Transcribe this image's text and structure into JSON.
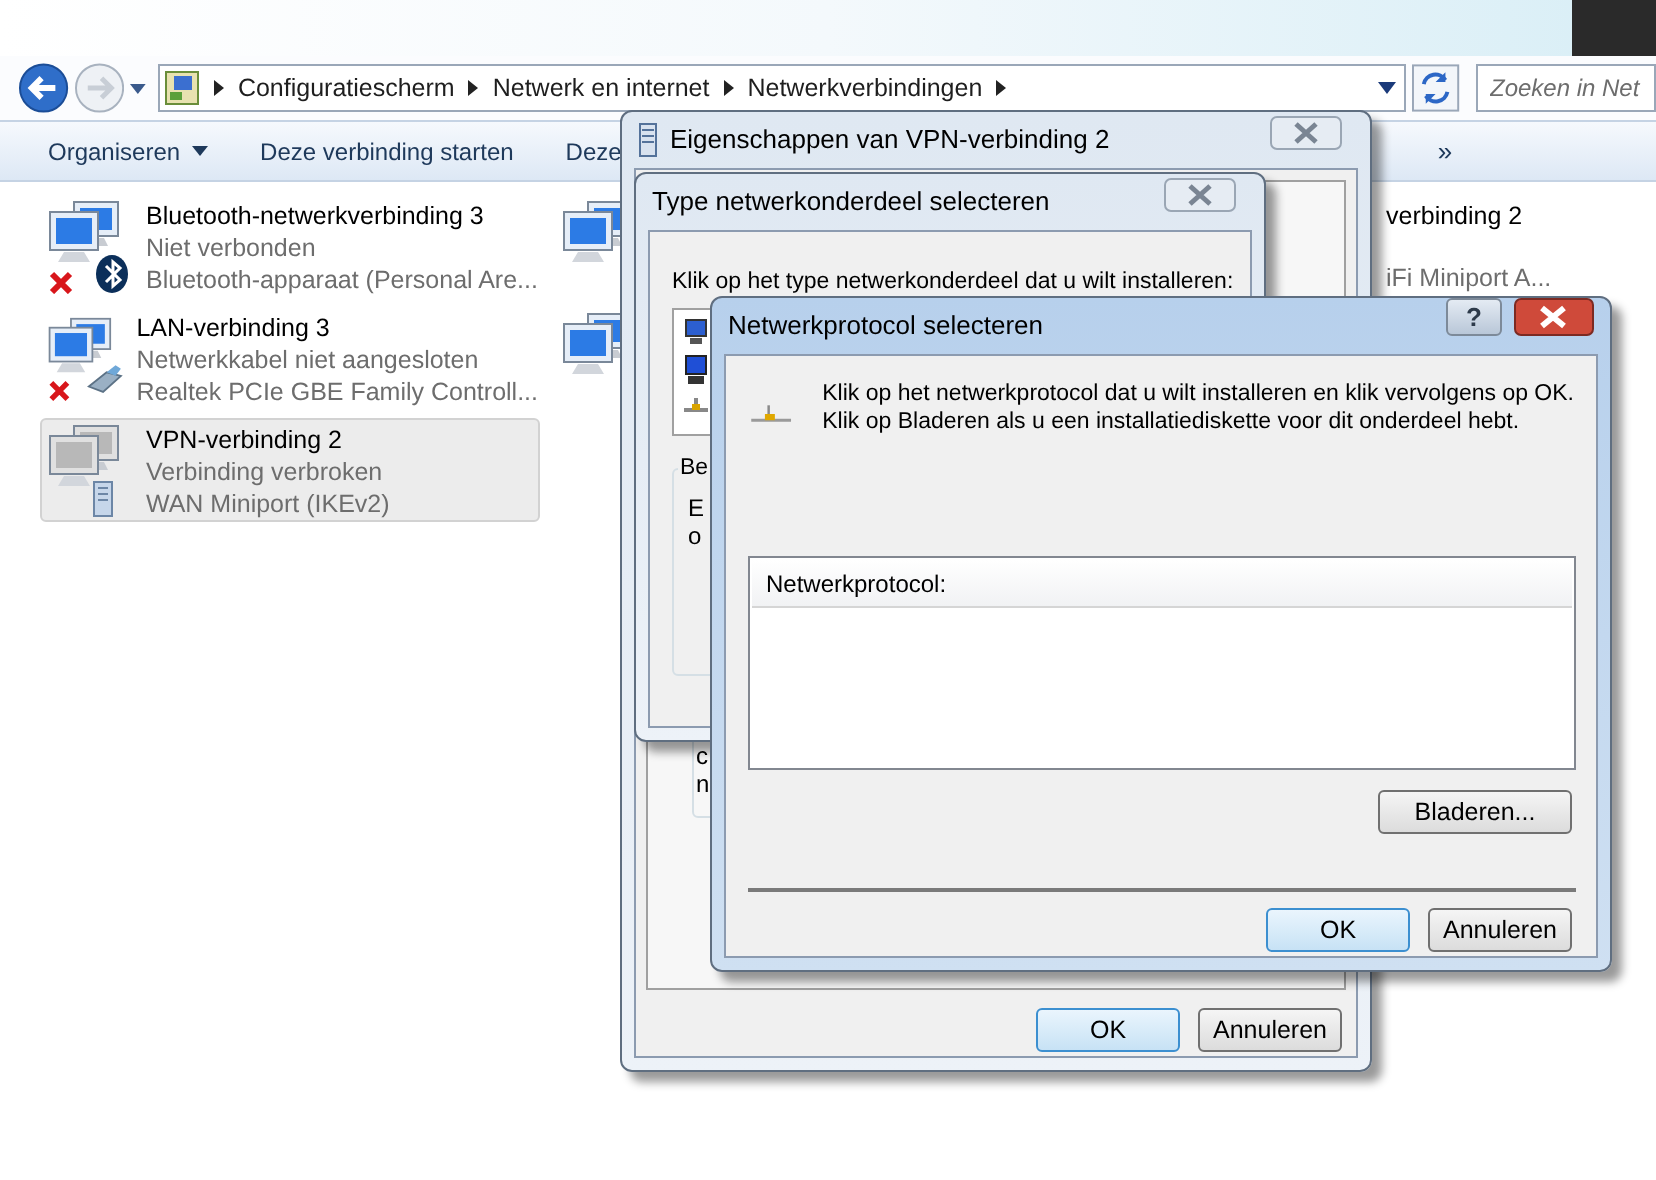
{
  "address_bar": {
    "path": [
      "Configuratiescherm",
      "Netwerk en internet",
      "Netwerkverbindingen"
    ]
  },
  "search": {
    "placeholder": "Zoeken in Net"
  },
  "toolbar": {
    "items": [
      {
        "label": "Organiseren",
        "has_menu": true
      },
      {
        "label": "Deze verbinding starten",
        "has_menu": false
      },
      {
        "label": "Deze",
        "has_menu": false
      }
    ],
    "overflow": "»"
  },
  "connections": [
    {
      "name": "Bluetooth-netwerkverbinding 3",
      "status": "Niet verbonden",
      "device": "Bluetooth-apparaat (Personal Are...",
      "kind": "bluetooth",
      "error": true,
      "selected": false
    },
    {
      "name": "LAN-verbinding 3",
      "status": "Netwerkkabel niet aangesloten",
      "device": "Realtek PCIe GBE Family Controll...",
      "kind": "cable",
      "error": true,
      "selected": false
    },
    {
      "name": "VPN-verbinding 2",
      "status": "Verbinding verbroken",
      "device": "WAN Miniport (IKEv2)",
      "kind": "vpn",
      "error": false,
      "selected": true
    }
  ],
  "partial_column": [
    "verbinding 2",
    "iFi Miniport A..."
  ],
  "properties_dialog": {
    "title": "Eigenschappen van VPN-verbinding 2",
    "fragments": [
      "c",
      "n"
    ],
    "buttons": [
      {
        "label": "OK",
        "default": true
      },
      {
        "label": "Annuleren",
        "default": false
      }
    ]
  },
  "type_dialog": {
    "title": "Type netwerkonderdeel selecteren",
    "instruction": "Klik op het type netwerkonderdeel dat u wilt installeren:",
    "group_label": "Be",
    "fragments": [
      "E",
      "o"
    ]
  },
  "protocol_dialog": {
    "title": "Netwerkprotocol selecteren",
    "help_button": "?",
    "instruction_lines": [
      "Klik op het netwerkprotocol dat u wilt installeren en klik vervolgens op OK.",
      "Klik op Bladeren als u een installatiediskette voor dit onderdeel hebt."
    ],
    "list_header": "Netwerkprotocol:",
    "browse_button": "Bladeren...",
    "buttons": [
      {
        "label": "OK",
        "default": true
      },
      {
        "label": "Annuleren",
        "default": false
      }
    ]
  }
}
